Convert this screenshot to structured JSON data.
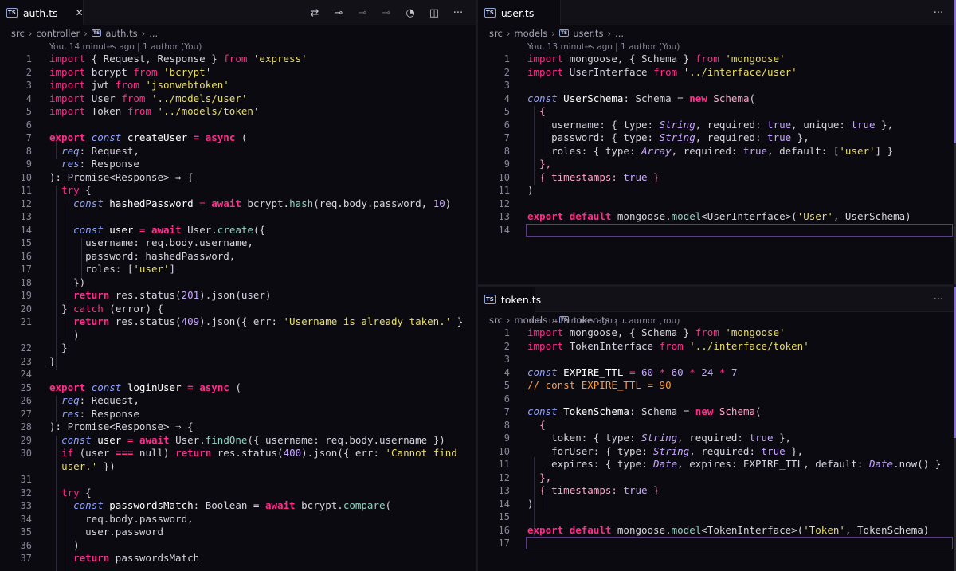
{
  "left": {
    "tab": {
      "badge": "TS",
      "name": "auth.ts",
      "close": "✕"
    },
    "breadcrumb": [
      "src",
      "controller",
      "auth.ts",
      "..."
    ],
    "blame": "You, 14 minutes ago | 1 author (You)",
    "line_numbers": [
      "1",
      "2",
      "3",
      "4",
      "5",
      "6",
      "7",
      "8",
      "9",
      "10",
      "11",
      "12",
      "13",
      "14",
      "15",
      "16",
      "17",
      "18",
      "19",
      "20",
      "21",
      "",
      "22",
      "23",
      "24",
      "25",
      "26",
      "27",
      "28",
      "29",
      "30",
      "",
      "31",
      "32",
      "33",
      "34",
      "35",
      "36",
      "37"
    ]
  },
  "top_right": {
    "tab": {
      "badge": "TS",
      "name": "user.ts"
    },
    "breadcrumb": [
      "src",
      "models",
      "user.ts",
      "..."
    ],
    "blame": "You, 13 minutes ago | 1 author (You)",
    "line_numbers": [
      "1",
      "2",
      "3",
      "4",
      "5",
      "6",
      "7",
      "8",
      "9",
      "10",
      "11",
      "12",
      "13",
      "14"
    ]
  },
  "bottom_right": {
    "tab": {
      "badge": "TS",
      "name": "token.ts"
    },
    "breadcrumb": [
      "src",
      "models",
      "token.ts",
      "..."
    ],
    "blame": "You, 14 minutes ago | 1 author (You)",
    "line_numbers": [
      "1",
      "2",
      "3",
      "4",
      "5",
      "6",
      "7",
      "8",
      "9",
      "10",
      "11",
      "12",
      "13",
      "14",
      "15",
      "16",
      "17"
    ]
  },
  "actions_more": "···",
  "tokens": {
    "import": "import",
    "from": "from",
    "export": "export",
    "const": "const",
    "async": "async",
    "try": "try",
    "await": "await",
    "return": "return",
    "catch": "catch",
    "if": "if",
    "new": "new",
    "default": "default",
    "l_l1": "{ Request, Response }",
    "s_express": "'express'",
    "l_bcrypt": "bcrypt",
    "s_bcrypt": "'bcrypt'",
    "l_jwt": "jwt",
    "s_jwt": "'jsonwebtoken'",
    "l_User": "User",
    "s_user": "'../models/user'",
    "l_Token": "Token",
    "s_token": "'../models/token'",
    "createUser": "createUser",
    "eq_paren": "= ",
    "req": "req",
    "res": "res",
    "colon_Request": ": Request,",
    "colon_Response": ": Response",
    "promise": "): Promise<Response> ⇒ {",
    "open_brace": "{",
    "hashed": "hashedPassword",
    "eq": "=",
    "bcrypt_dot": "bcrypt.",
    "hash": "hash",
    "hash_args": "(req.body.password, ",
    "ten": "10",
    "close_paren": ")",
    "user_var": "user",
    "User_dot": "User.",
    "create": "create",
    "create_open": "({",
    "username_line": "username: req.body.username,",
    "password_line": "password: hashedPassword,",
    "roles_label": "roles: [",
    "s_user_role": "'user'",
    "close_bracket": "]",
    "close_obj": "})",
    "res_status": "res.status(",
    "n201": "201",
    "json_user": ").json(user)",
    "catch_rest": "(error) {",
    "n409": "409",
    "json_err_open": ").json({ err: ",
    "s_taken": "'Username is already taken.'",
    "close_brace": "}",
    "loginUser": "loginUser",
    "User_findOne": "User.",
    "findOne": "findOne",
    "findOne_args": "({ username: req.body.username })",
    "if_open": "(user ",
    "strict_eq": "===",
    "null_close": " null) ",
    "n400": "400",
    "s_cannot": "'Cannot find",
    "s_cannot2": "user.'",
    "close_obj_paren": " })",
    "passwordsMatch": "passwordsMatch",
    "colon_Boolean": ": Boolean = ",
    "compare": "compare",
    "open_paren": "(",
    "reqpw": "req.body.password,",
    "userpw": "user.password",
    "mongoose_line": "mongoose, { Schema }",
    "s_mongoose": "'mongoose'",
    "UserInterface": "UserInterface",
    "s_iface_user": "'../interface/user'",
    "UserSchema": "UserSchema",
    "colon_Schema": ": Schema = ",
    "Schema": "Schema",
    "schema_open": "(",
    "username_k": "username: { type: ",
    "String": "String",
    "required_k": ", required: ",
    "true": "true",
    "unique_k": ", unique: ",
    "close_obj_comma": " },",
    "password_k": "password: { type: ",
    "roles_k": "roles: { type: ",
    "Array": "Array",
    "default_k": ", default: [",
    "close_arr_obj": "] }",
    "close_brace_comma": "},",
    "timestamps_k": "{ timestamps: ",
    "close_brace_sp": " }",
    "mongoose_model": "mongoose.",
    "model": "model",
    "model_user": "<UserInterface>(",
    "s_User": "'User'",
    "comma_UserSchema": ", UserSchema)",
    "TokenInterface": "TokenInterface",
    "s_iface_token": "'../interface/token'",
    "EXPIRE_TTL": "EXPIRE_TTL",
    "eq_sp": " = ",
    "n60": "60",
    "mul": " * ",
    "n24": "24",
    "n7": "7",
    "comment_ttl": "// const EXPIRE_TTL = 90",
    "TokenSchema": "TokenSchema",
    "token_k": "token: { type: ",
    "forUser_k": "forUser: { type: ",
    "expires_k": "expires: { type: ",
    "Date": "Date",
    "expires_k2": ", expires: EXPIRE_TTL, default: ",
    "Date_dot": "Date",
    "now": ".now() }",
    "model_token": "<TokenInterface>(",
    "s_Token": "'Token'",
    "comma_TokenSchema": ", TokenSchema)"
  }
}
